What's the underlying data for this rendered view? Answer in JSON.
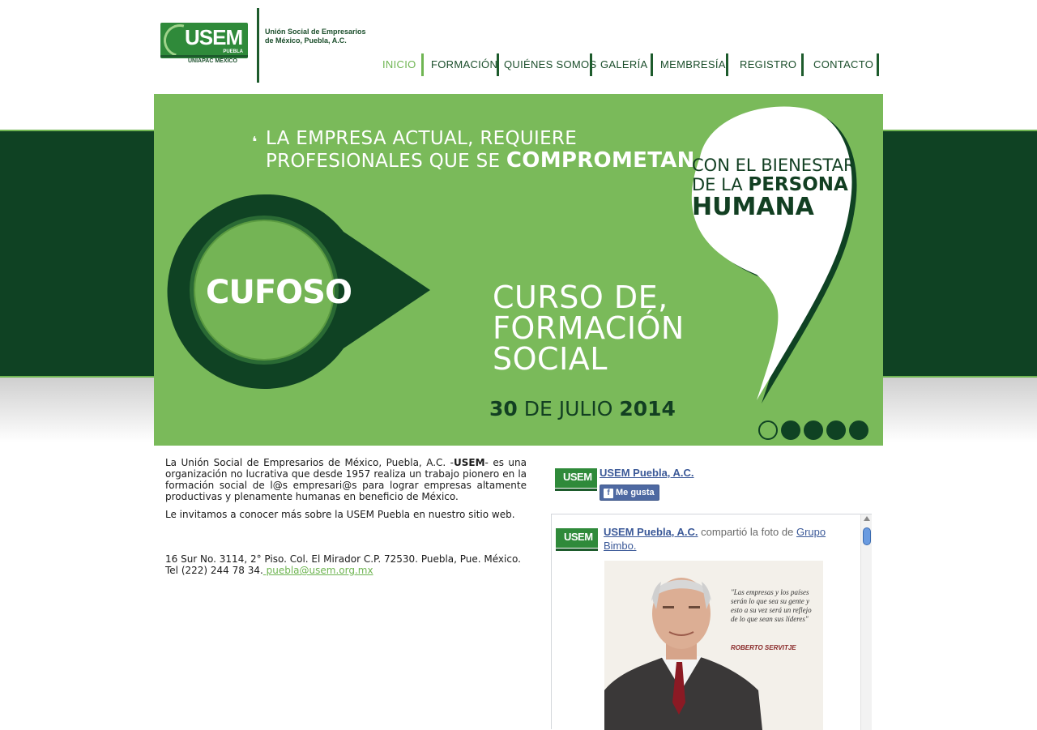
{
  "header": {
    "logo_text": "USEM",
    "logo_sub": "PUEBLA",
    "logo_uniapac": "UNIAPAC MÉXICO",
    "org_name_line1": "Unión Social de Empresarios",
    "org_name_line2": "de México, Puebla, A.C."
  },
  "nav": {
    "items": [
      {
        "label": "INICIO"
      },
      {
        "label": "FORMACIÓN"
      },
      {
        "label": "QUIÉNES SOMOS"
      },
      {
        "label": "GALERÍA"
      },
      {
        "label": "MEMBRESÍA"
      },
      {
        "label": "REGISTRO"
      },
      {
        "label": "CONTACTO"
      }
    ],
    "active_index": 0
  },
  "slider": {
    "headline_line1": "LA EMPRESA ACTUAL, REQUIERE",
    "headline_line2_prefix": "PROFESIONALES QUE SE ",
    "headline_line2_bold": "COMPROMETAN",
    "bubble_line1": "CON EL BIENESTAR",
    "bubble_line2_prefix": "DE LA ",
    "bubble_line2_bold": "PERSONA",
    "bubble_line3": "HUMANA",
    "cufoso": "CUFOSO",
    "course_line1": "CURSO DE,",
    "course_line2": "FORMACIÓN",
    "course_line3": "SOCIAL",
    "date_day": "30",
    "date_middle": " DE JULIO ",
    "date_year": "2014",
    "slide_count": 5,
    "active_slide": 0,
    "colors": {
      "green": "#7aba5a",
      "dark": "#0f4223"
    }
  },
  "main": {
    "intro_prefix": "La Unión Social de Empresarios de México, Puebla, A.C. -",
    "intro_bold": "USEM",
    "intro_suffix": "- es una organización no lucrativa que desde 1957 realiza un trabajo pionero en la formación social de l@s empresari@s para lograr empresas altamente productivas y plenamente humanas en beneficio de México.",
    "invite": "Le invitamos a conocer más sobre la USEM Puebla en nuestro sitio web.",
    "address_line1": "16 Sur No. 3114, 2° Piso. Col. El Mirador C.P. 72530. Puebla, Pue. México.",
    "address_tel": "Tel (222) 244 78 34.",
    "email": " puebla@usem.org.mx"
  },
  "facebook": {
    "page_name": "USEM Puebla, A.C.",
    "like_label": "Me gusta",
    "like_icon": "facebook-f-icon",
    "post_author": "USEM Puebla, A.C.",
    "post_action": " compartió la foto de ",
    "post_source": "Grupo Bimbo.",
    "photo_quote": "\"Las empresas y los países serán lo que sea su gente y esto a su vez será un reflejo de lo que sean sus líderes\"",
    "photo_author": "ROBERTO SERVITJE",
    "logo_text": "USEM"
  }
}
